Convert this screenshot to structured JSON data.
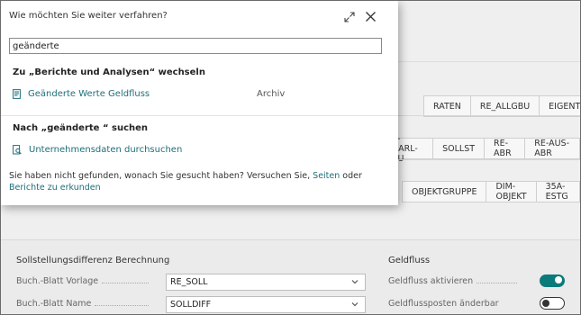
{
  "dialog": {
    "title": "Wie möchten Sie weiter verfahren?",
    "search_value": "geänderte",
    "groups": [
      {
        "title": "Zu „Berichte und Analysen“ wechseln",
        "items": [
          {
            "label": "Geänderte Werte Geldfluss",
            "category": "Archiv",
            "icon": "report-icon"
          }
        ]
      },
      {
        "title": "Nach „geänderte “ suchen",
        "items": [
          {
            "label": "Unternehmensdaten durchsuchen",
            "icon": "search-data-icon"
          }
        ]
      }
    ],
    "footer": {
      "text_before": "Sie haben nicht gefunden, wonach Sie gesucht haben? Versuchen Sie, ",
      "link_pages": "Seiten",
      "text_middle": " oder ",
      "link_reports": "Berichte zu erkunden"
    }
  },
  "background": {
    "tabs_row1": [
      "RATEN",
      "RE_ALLGBU",
      "EIGENTÜMER"
    ],
    "tabs_row2": [
      "E-DARL-BU",
      "SOLLST",
      "RE-ABR",
      "RE-AUS-ABR"
    ],
    "tabs_row3": [
      "OBJEKTGRUPPE",
      "DIM-OBJEKT",
      "35A-ESTG"
    ],
    "section_left": {
      "title": "Sollstellungsdifferenz Berechnung",
      "fields": [
        {
          "label": "Buch.-Blatt Vorlage",
          "value": "RE_SOLL"
        },
        {
          "label": "Buch.-Blatt Name",
          "value": "SOLLDIFF"
        }
      ]
    },
    "section_right": {
      "title": "Geldfluss",
      "toggles": [
        {
          "label": "Geldfluss aktivieren",
          "on": true
        },
        {
          "label": "Geldflussposten änderbar",
          "on": false
        }
      ]
    }
  },
  "colors": {
    "accent": "#0b7a7a",
    "link": "#1e6f7a"
  }
}
